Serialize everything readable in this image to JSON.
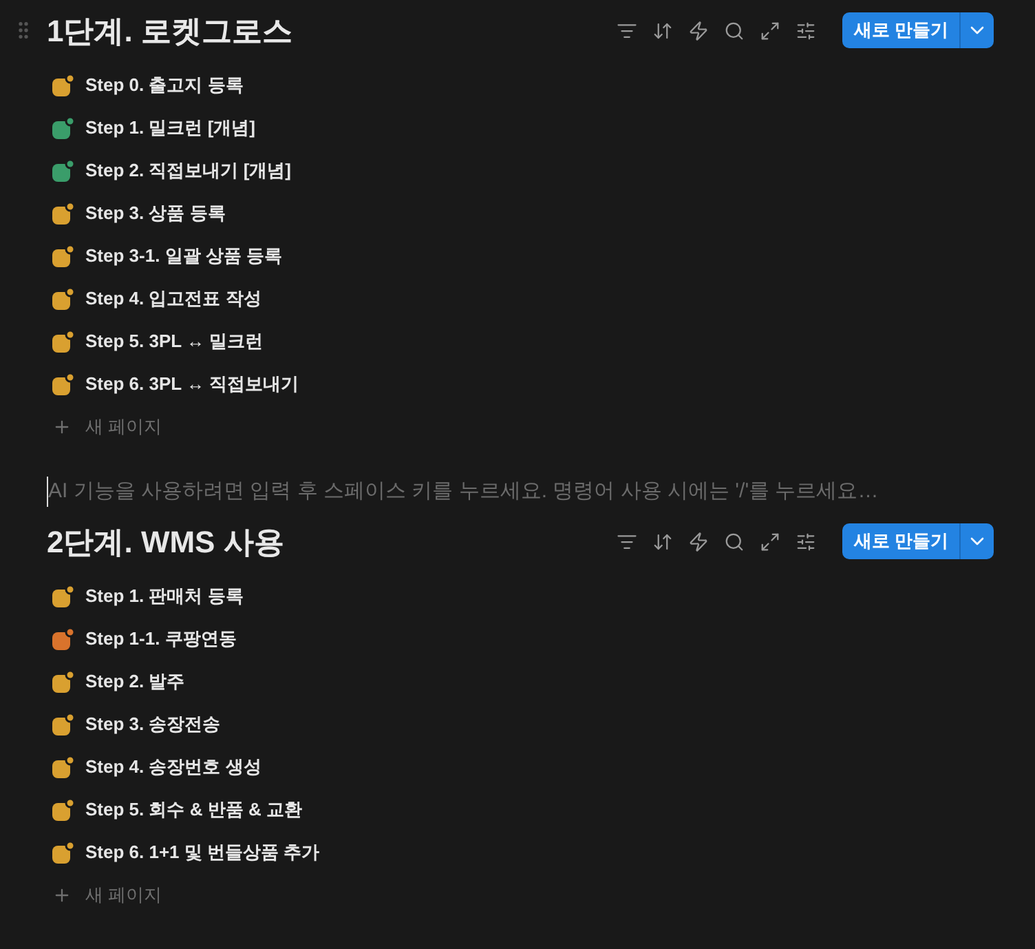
{
  "sections": [
    {
      "title": "1단계. 로켓그로스",
      "new_button": "새로 만들기",
      "add_page": "새 페이지",
      "items": [
        {
          "label": "Step 0. 출고지 등록",
          "color": "#d9a030"
        },
        {
          "label": "Step 1. 밀크런 [개념]",
          "color": "#3a9d6a"
        },
        {
          "label": "Step 2. 직접보내기 [개념]",
          "color": "#3a9d6a"
        },
        {
          "label": "Step 3. 상품 등록",
          "color": "#d9a030"
        },
        {
          "label": "Step 3-1. 일괄 상품 등록",
          "color": "#d9a030"
        },
        {
          "label": "Step 4. 입고전표 작성",
          "color": "#d9a030"
        },
        {
          "label": "Step 5. 3PL ↔ 밀크런",
          "color": "#d9a030"
        },
        {
          "label": "Step 6. 3PL ↔ 직접보내기",
          "color": "#d9a030"
        }
      ]
    },
    {
      "placeholder": "AI 기능을 사용하려면 입력 후 스페이스 키를 누르세요. 명령어 사용 시에는 '/'를 누르세요…",
      "title": "2단계. WMS 사용",
      "new_button": "새로 만들기",
      "add_page": "새 페이지",
      "items": [
        {
          "label": "Step 1. 판매처 등록",
          "color": "#d9a030"
        },
        {
          "label": "Step 1-1. 쿠팡연동",
          "color": "#d9732c"
        },
        {
          "label": "Step 2. 발주",
          "color": "#d9a030"
        },
        {
          "label": "Step 3. 송장전송",
          "color": "#d9a030"
        },
        {
          "label": "Step 4. 송장번호 생성",
          "color": "#d9a030"
        },
        {
          "label": "Step 5. 회수 & 반품 & 교환",
          "color": "#d9a030"
        },
        {
          "label": "Step 6. 1+1 및 번들상품 추가",
          "color": "#d9a030"
        }
      ]
    }
  ]
}
